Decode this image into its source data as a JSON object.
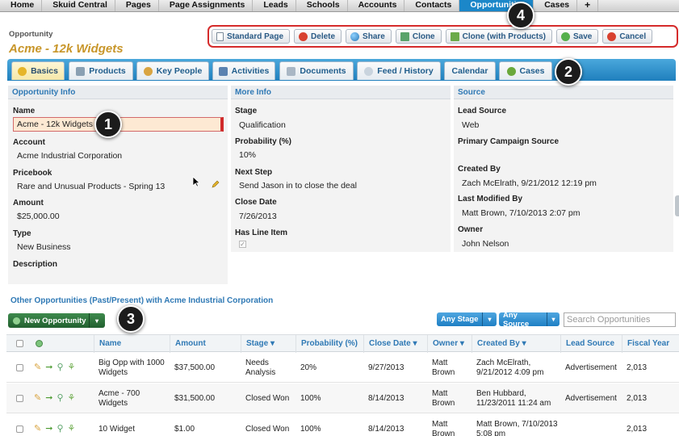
{
  "nav": {
    "items": [
      "Home",
      "Skuid Central",
      "Pages",
      "Page Assignments",
      "Leads",
      "Schools",
      "Accounts",
      "Contacts",
      "Opportunities",
      "Cases",
      "+"
    ],
    "active": "Opportunities"
  },
  "header": {
    "object_type": "Opportunity",
    "title": "Acme - 12k Widgets"
  },
  "actions": [
    "Standard Page",
    "Delete",
    "Share",
    "Clone",
    "Clone (with Products)",
    "Save",
    "Cancel"
  ],
  "tabs": [
    "Basics",
    "Products",
    "Key People",
    "Activities",
    "Documents",
    "Feed / History",
    "Calendar",
    "Cases"
  ],
  "opportunity_info": {
    "header": "Opportunity Info",
    "name_label": "Name",
    "name_value": "Acme - 12k Widgets",
    "account_label": "Account",
    "account_value": "Acme Industrial Corporation",
    "pricebook_label": "Pricebook",
    "pricebook_value": "Rare and Unusual Products - Spring 13",
    "amount_label": "Amount",
    "amount_value": "$25,000.00",
    "type_label": "Type",
    "type_value": "New Business",
    "description_label": "Description"
  },
  "more_info": {
    "header": "More Info",
    "stage_label": "Stage",
    "stage_value": "Qualification",
    "probability_label": "Probability (%)",
    "probability_value": "10%",
    "next_step_label": "Next Step",
    "next_step_value": "Send Jason in to close the deal",
    "close_date_label": "Close Date",
    "close_date_value": "7/26/2013",
    "has_line_item_label": "Has Line Item",
    "has_line_item_mark": "✓"
  },
  "source": {
    "header": "Source",
    "lead_source_label": "Lead Source",
    "lead_source_value": "Web",
    "campaign_label": "Primary Campaign Source",
    "created_by_label": "Created By",
    "created_by_value": "Zach McElrath, 9/21/2012 12:19 pm",
    "modified_label": "Last Modified By",
    "modified_value": "Matt Brown, 7/10/2013 2:07 pm",
    "owner_label": "Owner",
    "owner_value": "John Nelson"
  },
  "callouts": [
    "1",
    "2",
    "3",
    "4"
  ],
  "related": {
    "title": "Other Opportunities (Past/Present) with Acme Industrial Corporation",
    "new_button": "New Opportunity",
    "caret": "▾",
    "filter_stage": "Any Stage",
    "filter_source": "Any Source",
    "search_placeholder": "Search Opportunities",
    "columns": [
      "Name",
      "Amount",
      "Stage",
      "Probability (%)",
      "Close Date",
      "Owner",
      "Created By",
      "Lead Source",
      "Fiscal Year"
    ],
    "sort_marks": [
      "",
      "",
      "▾",
      "",
      "▾",
      "▾",
      "▾",
      "",
      ""
    ],
    "rows": [
      {
        "name": "Big Opp with 1000 Widgets",
        "amount": "$37,500.00",
        "stage": "Needs Analysis",
        "probability": "20%",
        "close_date": "9/27/2013",
        "owner": "Matt Brown",
        "created_by": "Zach McElrath, 9/21/2012 4:09 pm",
        "lead_source": "Advertisement",
        "fiscal_year": "2,013"
      },
      {
        "name": "Acme - 700 Widgets",
        "amount": "$31,500.00",
        "stage": "Closed Won",
        "probability": "100%",
        "close_date": "8/14/2013",
        "owner": "Matt Brown",
        "created_by": "Ben Hubbard, 11/23/2011 11:24 am",
        "lead_source": "Advertisement",
        "fiscal_year": "2,013"
      },
      {
        "name": "10 Widget",
        "amount": "$1.00",
        "stage": "Closed Won",
        "probability": "100%",
        "close_date": "8/14/2013",
        "owner": "Matt Brown",
        "created_by": "Matt Brown, 7/10/2013 5:08 pm",
        "lead_source": "",
        "fiscal_year": "2,013"
      }
    ]
  },
  "colors": {
    "accent": "#1b87c9",
    "title": "#c8962a",
    "section": "#2f79b5",
    "highlight": "#d52b2b",
    "new_button": "#2d7a3e"
  },
  "icons": {
    "actions": [
      "document-icon",
      "delete-icon",
      "share-icon",
      "clone-icon",
      "clone-products-icon",
      "save-icon",
      "cancel-icon"
    ],
    "tabs": [
      "star-icon",
      "cart-icon",
      "people-icon",
      "calendar-icon",
      "document-icon",
      "comment-icon",
      "calendar-icon",
      "gear-icon"
    ]
  }
}
